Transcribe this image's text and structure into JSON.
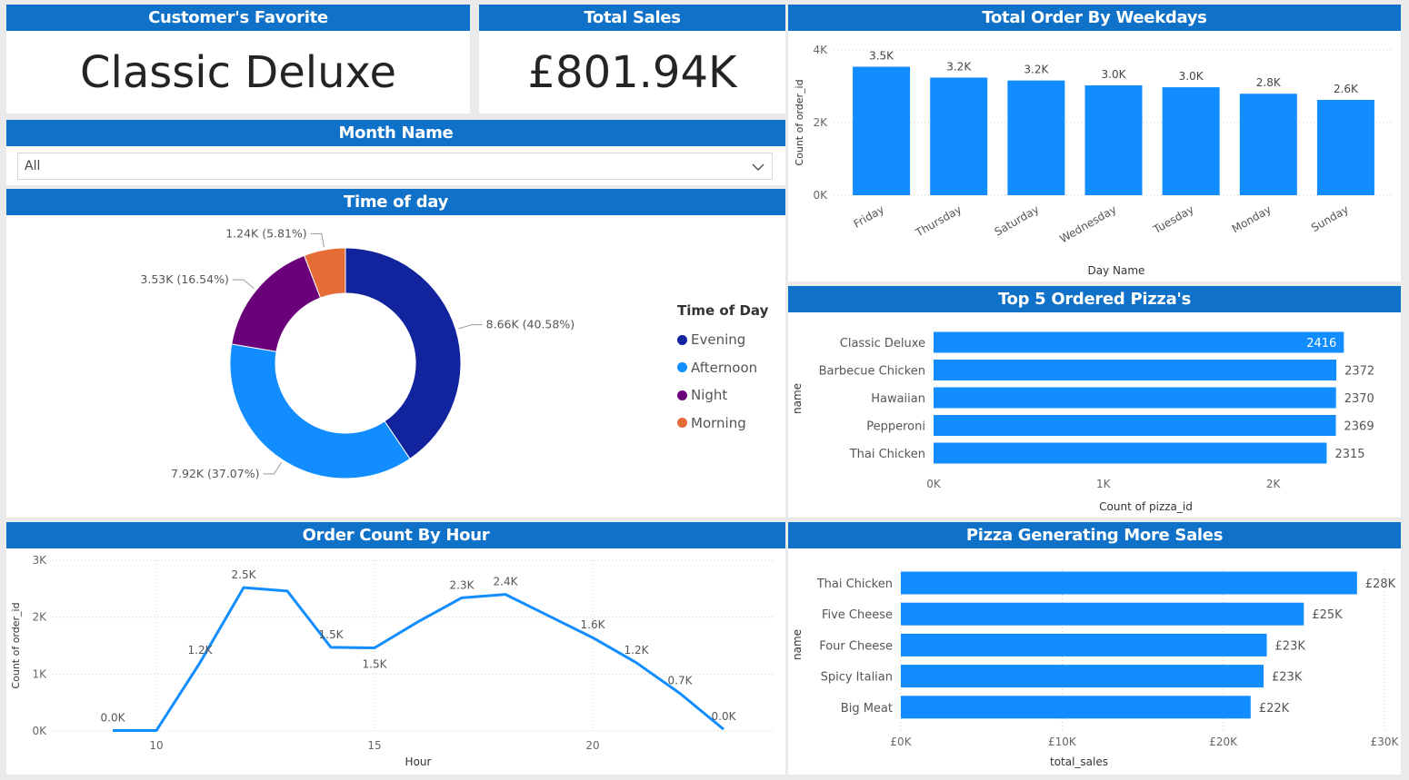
{
  "cards": {
    "favorite": {
      "title": "Customer's Favorite",
      "value": "Classic Deluxe"
    },
    "sales": {
      "title": "Total Sales",
      "value": "£801.94K"
    }
  },
  "slicer": {
    "title": "Month Name",
    "value": "All"
  },
  "colors": {
    "header": "#1071c8",
    "bar": "#118dff",
    "evening": "#12239e",
    "afternoon": "#118dff",
    "night": "#6b007b",
    "morning": "#e66c37"
  },
  "chart_data": [
    {
      "id": "weekdays",
      "type": "bar",
      "title": "Total Order By Weekdays",
      "xlabel": "Day Name",
      "ylabel": "Count of order_id",
      "categories": [
        "Friday",
        "Thursday",
        "Saturday",
        "Wednesday",
        "Tuesday",
        "Monday",
        "Sunday"
      ],
      "values": [
        3538,
        3239,
        3158,
        3024,
        2973,
        2794,
        2624
      ],
      "data_labels": [
        "3.5K",
        "3.2K",
        "3.2K",
        "3.0K",
        "3.0K",
        "2.8K",
        "2.6K"
      ],
      "yticks": [
        "0K",
        "2K",
        "4K"
      ],
      "ylim": [
        0,
        4000
      ],
      "grid": true
    },
    {
      "id": "timeofday",
      "type": "pie",
      "title": "Time of day",
      "legend_title": "Time of Day",
      "legend_position": "right",
      "categories": [
        "Evening",
        "Afternoon",
        "Night",
        "Morning"
      ],
      "values": [
        8660,
        7920,
        3530,
        1240
      ],
      "data_labels": [
        "8.66K (40.58%)",
        "7.92K (37.07%)",
        "3.53K (16.54%)",
        "1.24K (5.81%)"
      ]
    },
    {
      "id": "top5",
      "type": "bar",
      "orientation": "horizontal",
      "title": "Top 5 Ordered Pizza's",
      "xlabel": "Count of pizza_id",
      "ylabel": "name",
      "categories": [
        "Classic Deluxe",
        "Barbecue Chicken",
        "Hawaiian",
        "Pepperoni",
        "Thai Chicken"
      ],
      "values": [
        2416,
        2372,
        2370,
        2369,
        2315
      ],
      "data_labels": [
        "2416",
        "2372",
        "2370",
        "2369",
        "2315"
      ],
      "xticks": [
        "0K",
        "1K",
        "2K"
      ],
      "xlim": [
        0,
        2500
      ]
    },
    {
      "id": "hour",
      "type": "line",
      "title": "Order Count By Hour",
      "xlabel": "Hour",
      "ylabel": "Count of order_id",
      "x": [
        9,
        10,
        11,
        12,
        13,
        14,
        15,
        16,
        17,
        18,
        19,
        20,
        21,
        22,
        23
      ],
      "y": [
        8,
        8,
        1200,
        2520,
        2460,
        1470,
        1460,
        1920,
        2340,
        2400,
        2020,
        1640,
        1200,
        660,
        30
      ],
      "data_labels": [
        "0.0K",
        "",
        "1.2K",
        "2.5K",
        "",
        "1.5K",
        "1.5K",
        "",
        "2.3K",
        "2.4K",
        "",
        "1.6K",
        "1.2K",
        "0.7K",
        "0.0K"
      ],
      "xticks": [
        "10",
        "15",
        "20"
      ],
      "yticks": [
        "0K",
        "1K",
        "2K",
        "3K"
      ],
      "ylim": [
        0,
        3000
      ],
      "grid": true
    },
    {
      "id": "sales",
      "type": "bar",
      "orientation": "horizontal",
      "title": "Pizza Generating More Sales",
      "xlabel": "total_sales",
      "ylabel": "name",
      "categories": [
        "Thai Chicken",
        "Five Cheese",
        "Four Cheese",
        "Spicy Italian",
        "Big Meat"
      ],
      "values": [
        28300,
        25000,
        22700,
        22500,
        21700
      ],
      "data_labels": [
        "£28K",
        "£25K",
        "£23K",
        "£23K",
        "£22K"
      ],
      "xticks": [
        "£0K",
        "£10K",
        "£20K",
        "£30K"
      ],
      "xlim": [
        0,
        30000
      ],
      "grid": true
    }
  ]
}
